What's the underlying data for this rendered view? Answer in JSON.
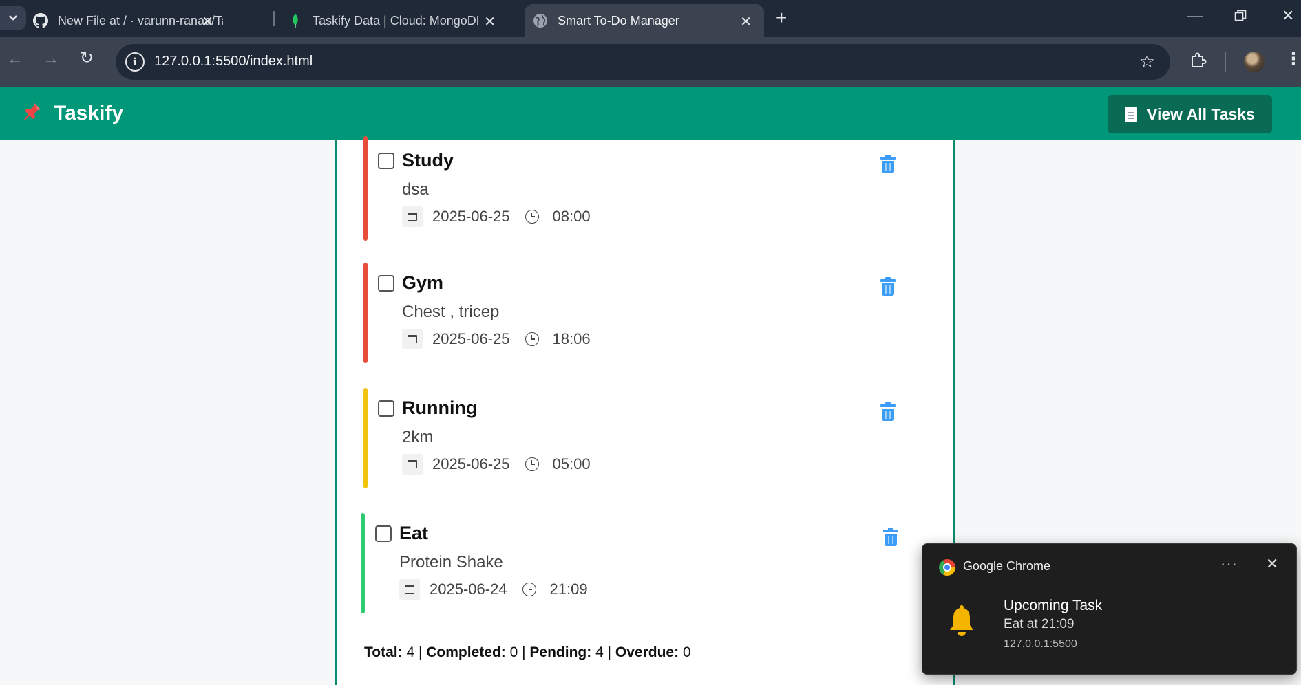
{
  "browser": {
    "tabs": [
      {
        "title": "New File at / · varunn-ranaa/Tas",
        "favicon": "github-icon",
        "active": false
      },
      {
        "title": "Taskify Data | Cloud: MongoDB",
        "favicon": "mongodb-leaf-icon",
        "active": false
      },
      {
        "title": "Smart To-Do Manager",
        "favicon": "globe-icon",
        "active": true
      }
    ],
    "url": "127.0.0.1:5500/index.html"
  },
  "app": {
    "brand": "Taskify",
    "brand_icon": "pushpin-icon",
    "view_all_label": "View All Tasks",
    "primary_color": "#009879"
  },
  "tasks": [
    {
      "title": "Study",
      "description": "dsa",
      "date": "2025-06-25",
      "time": "08:00",
      "priority_color": "#e74c3c"
    },
    {
      "title": "Gym",
      "description": "Chest , tricep",
      "date": "2025-06-25",
      "time": "18:06",
      "priority_color": "#e74c3c"
    },
    {
      "title": "Running",
      "description": "2km",
      "date": "2025-06-25",
      "time": "05:00",
      "priority_color": "#f1c40f"
    },
    {
      "title": "Eat",
      "description": "Protein Shake",
      "date": "2025-06-24",
      "time": "21:09",
      "priority_color": "#2ecc71"
    }
  ],
  "stats": {
    "total_label": "Total:",
    "total": "4",
    "completed_label": "Completed:",
    "completed": "0",
    "pending_label": "Pending:",
    "pending": "4",
    "overdue_label": "Overdue:",
    "overdue": "0"
  },
  "notification": {
    "app": "Google Chrome",
    "title": "Upcoming Task",
    "body": "Eat at 21:09",
    "origin": "127.0.0.1:5500"
  }
}
